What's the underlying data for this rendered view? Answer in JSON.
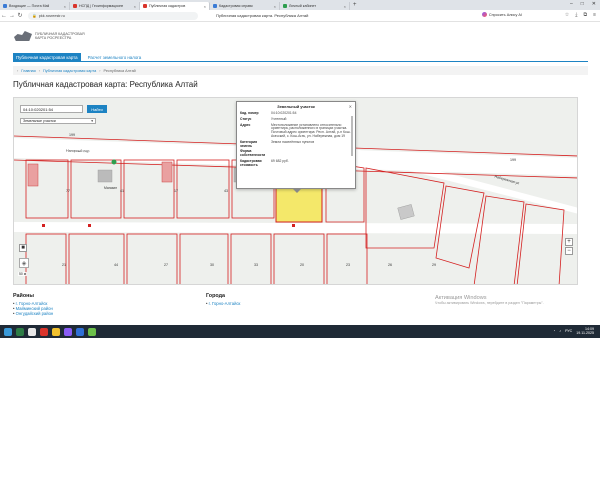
{
  "browser": {
    "tabs": [
      {
        "label": "Входящие — Почта Mail",
        "favicon": "mail-icon"
      },
      {
        "label": "НСПД | Геоинформационн",
        "favicon": "map-icon"
      },
      {
        "label": "Публичная кадастров",
        "favicon": "map-icon",
        "active": true
      },
      {
        "label": "Кадастровая справк",
        "favicon": "doc-icon"
      },
      {
        "label": "Личный кабинет",
        "favicon": "user-icon"
      }
    ],
    "new_tab": "+",
    "url": "pkk.rosreestr.ru",
    "page_title": "Публичная кадастровая карта. Республика Алтай",
    "alice": "Спросить Алису AI"
  },
  "site": {
    "logo_line1": "Публичная кадастровая",
    "logo_line2": "карта Росреестра",
    "tabs": [
      {
        "label": "Публичная кадастровая карта",
        "active": true
      },
      {
        "label": "Расчет земельного налога",
        "active": false
      }
    ],
    "breadcrumbs": [
      "Главная",
      "Публичная кадастровая карта"
    ],
    "breadcrumb_current": "Республика Алтай",
    "heading": "Публичная кадастровая карта: Республика Алтай"
  },
  "map": {
    "search_value": "04:10:020201:54",
    "search_button": "Найти",
    "object_type": "Земельные участки",
    "scale_label": "50 м",
    "zoom_in": "+",
    "zoom_out": "−",
    "road_label": "Нагорный пер",
    "road_label2": "Набережная ул",
    "parcel_labels": [
      "77",
      "41",
      "17",
      "43",
      "21",
      "44",
      "27",
      "30",
      "33",
      "20",
      "23",
      "26",
      "29",
      "199",
      "199",
      "Магазин"
    ],
    "popup": {
      "title": "Земельный участок",
      "close": "✕",
      "rows": [
        {
          "k": "Кад. номер",
          "v": "04:10:020201:54"
        },
        {
          "k": "Статус",
          "v": "Учтенный"
        },
        {
          "k": "Адрес",
          "v": "Местоположение установлено относительно ориентира, расположенного в границах участка. Почтовый адрес ориентира: Респ. Алтай, р-н Кош-Агачский, с. Кош-Агач, ул. Набережная, дом 19"
        },
        {
          "k": "Категория земель",
          "v": "Земли населённых пунктов"
        },
        {
          "k": "Форма собственности",
          "v": ""
        },
        {
          "k": "Кадастровая стоимость",
          "v": "69 682 руб."
        }
      ]
    }
  },
  "lists": {
    "districts_title": "Районы",
    "districts": [
      "г. Горно-Алтайск",
      "Майминский район",
      "Онгудайский район"
    ],
    "cities_title": "Города",
    "cities": [
      "г. Горно-Алтайск"
    ]
  },
  "watermark": {
    "line1": "Активация Windows",
    "line2": "Чтобы активировать Windows, перейдите в раздел \"Параметры\"."
  },
  "taskbar": {
    "time": "14:09",
    "date": "19.11.2025",
    "lang": "РУС"
  },
  "colors": {
    "accent": "#1d83c3",
    "parcel_border": "#d42020",
    "selected_parcel": "#f4e86a",
    "taskbar": "#1f2a36"
  }
}
